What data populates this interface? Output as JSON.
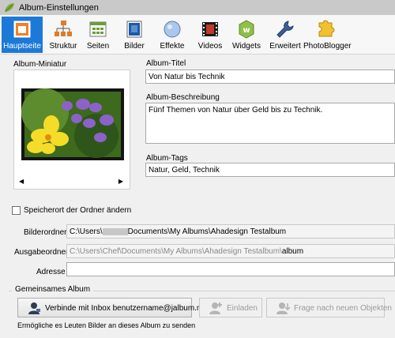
{
  "window": {
    "title": "Album-Einstellungen"
  },
  "toolbar": {
    "items": [
      {
        "label": "Hauptseite",
        "icon": "home-icon"
      },
      {
        "label": "Struktur",
        "icon": "tree-structure-icon"
      },
      {
        "label": "Seiten",
        "icon": "pages-icon"
      },
      {
        "label": "Bilder",
        "icon": "image-icon"
      },
      {
        "label": "Effekte",
        "icon": "effects-icon"
      },
      {
        "label": "Videos",
        "icon": "video-icon"
      },
      {
        "label": "Widgets",
        "icon": "widgets-icon"
      },
      {
        "label": "Erweitert",
        "icon": "wrench-icon"
      },
      {
        "label": "PhotoBlogger",
        "icon": "puzzle-icon"
      }
    ],
    "active": "Hauptseite"
  },
  "thumbnail": {
    "label": "Album-Miniatur",
    "prev": "◀",
    "next": "▶"
  },
  "album": {
    "title_label": "Album-Titel",
    "title_value": "Von Natur bis Technik",
    "description_label": "Album-Beschreibung",
    "description_value": "Fünf Themen von Natur über Geld bis zu Technik.",
    "tags_label": "Album-Tags",
    "tags_value": "Natur, Geld, Technik"
  },
  "folders": {
    "change_location_label": "Speicherort der Ordner ändern",
    "change_location_checked": false,
    "image_folder_label": "Bilderordner",
    "image_folder_prefix": "C:\\Users\\",
    "image_folder_suffix": "Documents\\My Albums\\Ahadesign Testalbum",
    "output_folder_label": "Ausgabeordner",
    "output_folder_prefix": "C:\\Users\\Chef\\Documents\\My Albums\\Ahadesign Testalbum\\",
    "output_folder_suffix": "album",
    "address_label": "Adresse",
    "address_value": ""
  },
  "shared": {
    "legend": "Gemeinsames Album",
    "connect_button": "Verbinde mit Inbox benutzername@jalbum.net",
    "invite_button": "Einladen",
    "ask_button": "Frage nach neuen Objekten",
    "note": "Ermögliche es Leuten Bilder an dieses Album zu senden"
  },
  "colors": {
    "active_tab": "#1c79d8",
    "titlebar": "#c9c9c9"
  }
}
